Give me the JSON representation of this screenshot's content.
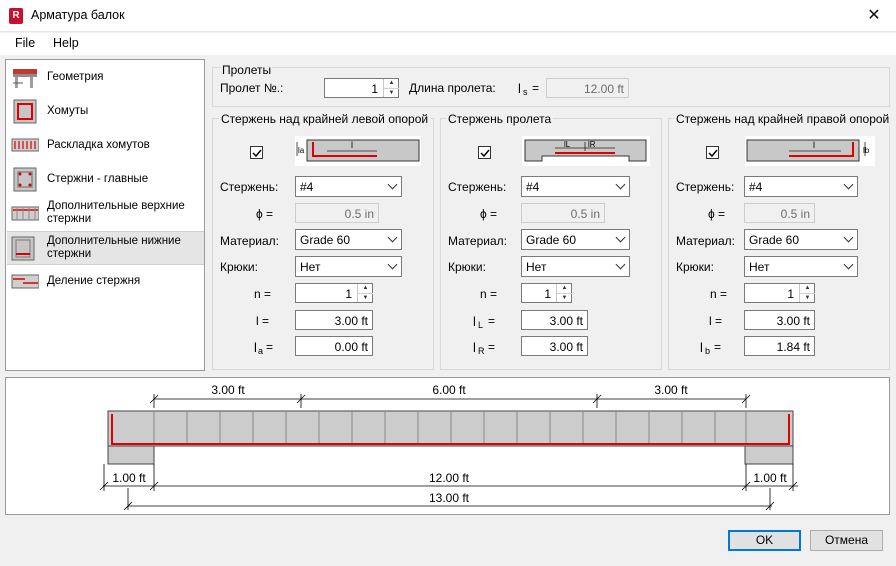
{
  "window": {
    "title": "Арматура балок",
    "app_icon_letter": "R",
    "close_glyph": "✕"
  },
  "menu": {
    "items": [
      "File",
      "Help"
    ]
  },
  "nav": {
    "items": [
      {
        "label": "Геометрия",
        "icon": "beam-geometry-icon"
      },
      {
        "label": "Хомуты",
        "icon": "stirrups-icon"
      },
      {
        "label": "Раскладка хомутов",
        "icon": "stirrup-layout-icon"
      },
      {
        "label": "Стержни - главные",
        "icon": "main-bars-icon"
      },
      {
        "label": "Дополнительные верхние стержни",
        "icon": "top-bars-icon"
      },
      {
        "label": "Дополнительные нижние стержни",
        "icon": "bottom-bars-icon",
        "selected": true
      },
      {
        "label": "Деление стержня",
        "icon": "bar-split-icon"
      }
    ]
  },
  "spans": {
    "group_title": "Пролеты",
    "span_no_label": "Пролет №.:",
    "span_no_value": "1",
    "span_length_label": "Длина пролета:",
    "ls_label": "l",
    "ls_sub": "s",
    "ls_eq": "=",
    "ls_value": "12.00 ft"
  },
  "left_support": {
    "title": "Стержень над крайней левой опорой",
    "checked": true,
    "diagram_label": "l",
    "diagram_side_label": "la",
    "bar_label": "Стержень:",
    "bar_value": "#4",
    "phi_label": "ϕ =",
    "phi_value": "0.5 in",
    "material_label": "Материал:",
    "material_value": "Grade 60",
    "hooks_label": "Крюки:",
    "hooks_value": "Нет",
    "n_label": "n =",
    "n_value": "1",
    "l_label": "l =",
    "l_value": "3.00 ft",
    "la_label": "l",
    "la_sub": "a",
    "la_eq": "=",
    "la_value": "0.00 ft"
  },
  "span_bar": {
    "title": "Стержень пролета",
    "checked": true,
    "diagram_label_l": "lL",
    "diagram_label_r": "lR",
    "bar_label": "Стержень:",
    "bar_value": "#4",
    "phi_label": "ϕ =",
    "phi_value": "0.5 in",
    "material_label": "Материал:",
    "material_value": "Grade 60",
    "hooks_label": "Крюки:",
    "hooks_value": "Нет",
    "n_label": "n =",
    "n_value": "1",
    "lL_label": "l",
    "lL_sub": "L",
    "lL_eq": "=",
    "lL_value": "3.00 ft",
    "lR_label": "l",
    "lR_sub": "R",
    "lR_eq": "=",
    "lR_value": "3.00 ft"
  },
  "right_support": {
    "title": "Стержень над крайней правой опорой",
    "checked": true,
    "diagram_label": "l",
    "diagram_side_label": "lb",
    "bar_label": "Стержень:",
    "bar_value": "#4",
    "phi_label": "ϕ =",
    "phi_value": "0.5 in",
    "material_label": "Материал:",
    "material_value": "Grade 60",
    "hooks_label": "Крюки:",
    "hooks_value": "Нет",
    "n_label": "n =",
    "n_value": "1",
    "l_label": "l =",
    "l_value": "3.00 ft",
    "lb_label": "l",
    "lb_sub": "b",
    "lb_eq": "=",
    "lb_value": "1.84 ft"
  },
  "preview": {
    "dim_left_bar": "3.00 ft",
    "dim_mid": "6.00 ft",
    "dim_right_bar": "3.00 ft",
    "dim_left_support": "1.00 ft",
    "dim_span": "12.00 ft",
    "dim_right_support": "1.00 ft",
    "dim_total": "13.00 ft",
    "rebar_color": "#e00000"
  },
  "buttons": {
    "ok": "OK",
    "cancel": "Отмена"
  }
}
